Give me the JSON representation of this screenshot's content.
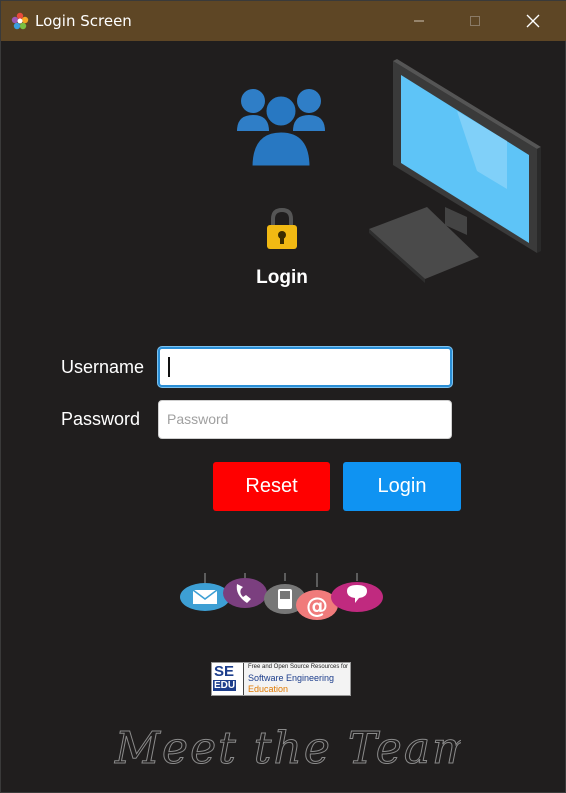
{
  "window": {
    "title": "Login Screen",
    "controls": [
      "minimize-icon",
      "maximize-icon",
      "close-icon"
    ]
  },
  "header": {
    "heading": "Login",
    "icons": [
      "users-group-icon",
      "desktop-monitor-icon",
      "padlock-icon"
    ]
  },
  "form": {
    "username_label": "Username",
    "username_value": "",
    "password_label": "Password",
    "password_placeholder": "Password",
    "password_value": ""
  },
  "buttons": {
    "reset_label": "Reset",
    "login_label": "Login"
  },
  "footer": {
    "contact_icons": [
      "email-icon",
      "phone-icon",
      "mobile-icon",
      "at-sign-icon",
      "chat-icon"
    ],
    "seedu": {
      "logo_top": "SE",
      "logo_bottom": "EDU",
      "line1": "Free and Open Source Resources for",
      "line2": "Software Engineering",
      "line3": "Education"
    },
    "signature": "Meet the Team"
  },
  "colors": {
    "titlebar": "#5e4625",
    "background": "#201e1e",
    "reset": "#ff0000",
    "login": "#0f93f2",
    "focus_border": "#2b8fd6"
  }
}
